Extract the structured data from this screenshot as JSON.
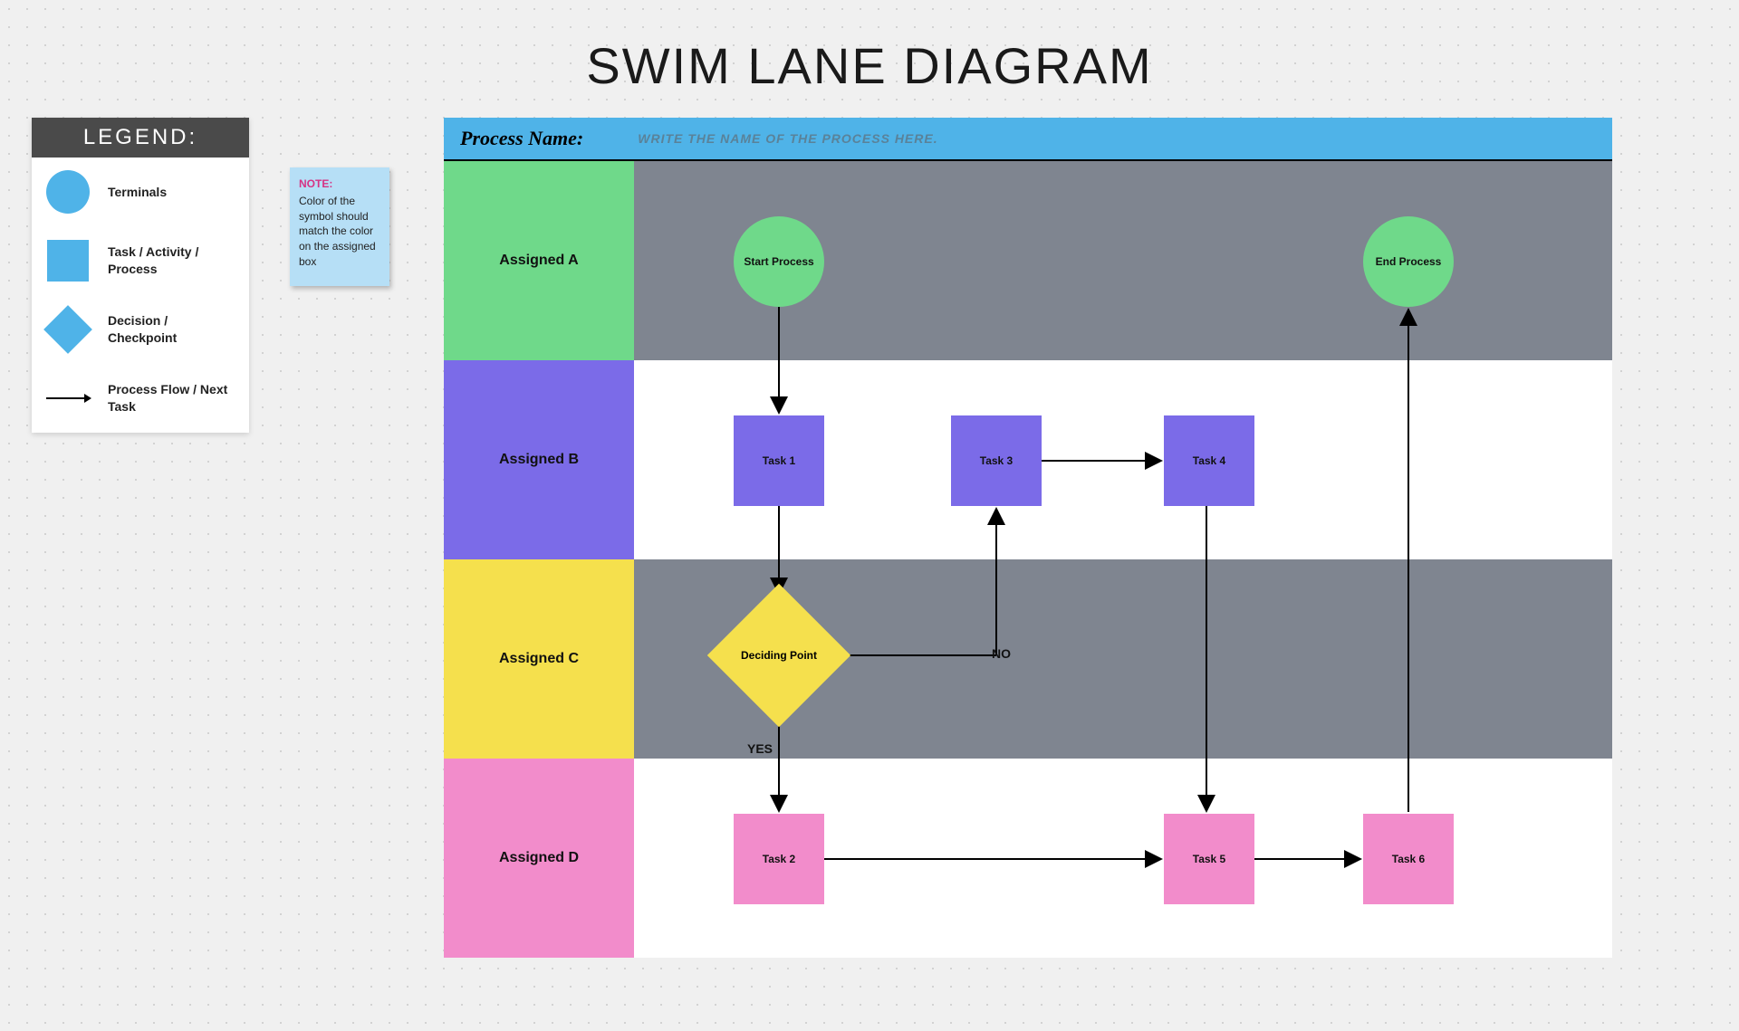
{
  "title": "SWIM LANE DIAGRAM",
  "legend": {
    "header": "LEGEND:",
    "items": [
      {
        "label": "Terminals"
      },
      {
        "label": "Task / Activity / Process"
      },
      {
        "label": "Decision / Checkpoint"
      },
      {
        "label": "Process Flow / Next Task"
      }
    ]
  },
  "note": {
    "label": "NOTE:",
    "body": "Color of the symbol should match the color on the assigned box"
  },
  "process": {
    "label": "Process Name:",
    "placeholder": "WRITE THE NAME OF THE PROCESS HERE."
  },
  "lanes": {
    "a": "Assigned A",
    "b": "Assigned B",
    "c": "Assigned C",
    "d": "Assigned D"
  },
  "nodes": {
    "start": "Start Process",
    "end": "End Process",
    "task1": "Task 1",
    "task2": "Task 2",
    "task3": "Task 3",
    "task4": "Task 4",
    "task5": "Task 5",
    "task6": "Task 6",
    "decision": "Deciding Point"
  },
  "edges": {
    "yes": "YES",
    "no": "NO"
  },
  "colors": {
    "blue": "#4fb3e8",
    "green": "#6fd98a",
    "purple": "#7b6be8",
    "yellow": "#f5e04d",
    "pink": "#f28ccb",
    "gray": "#7f8590"
  },
  "chart_data": {
    "type": "swimlane-flowchart",
    "title": "SWIM LANE DIAGRAM",
    "lanes": [
      {
        "id": "A",
        "label": "Assigned A",
        "color": "#6fd98a"
      },
      {
        "id": "B",
        "label": "Assigned B",
        "color": "#7b6be8"
      },
      {
        "id": "C",
        "label": "Assigned C",
        "color": "#f5e04d"
      },
      {
        "id": "D",
        "label": "Assigned D",
        "color": "#f28ccb"
      }
    ],
    "nodes": [
      {
        "id": "start",
        "lane": "A",
        "type": "terminal",
        "label": "Start Process"
      },
      {
        "id": "task1",
        "lane": "B",
        "type": "task",
        "label": "Task 1"
      },
      {
        "id": "decision",
        "lane": "C",
        "type": "decision",
        "label": "Deciding Point"
      },
      {
        "id": "task2",
        "lane": "D",
        "type": "task",
        "label": "Task 2"
      },
      {
        "id": "task3",
        "lane": "B",
        "type": "task",
        "label": "Task 3"
      },
      {
        "id": "task4",
        "lane": "B",
        "type": "task",
        "label": "Task 4"
      },
      {
        "id": "task5",
        "lane": "D",
        "type": "task",
        "label": "Task 5"
      },
      {
        "id": "task6",
        "lane": "D",
        "type": "task",
        "label": "Task 6"
      },
      {
        "id": "end",
        "lane": "A",
        "type": "terminal",
        "label": "End Process"
      }
    ],
    "edges": [
      {
        "from": "start",
        "to": "task1"
      },
      {
        "from": "task1",
        "to": "decision"
      },
      {
        "from": "decision",
        "to": "task2",
        "label": "YES"
      },
      {
        "from": "decision",
        "to": "task3",
        "label": "NO"
      },
      {
        "from": "task3",
        "to": "task4"
      },
      {
        "from": "task4",
        "to": "task5"
      },
      {
        "from": "task2",
        "to": "task5"
      },
      {
        "from": "task5",
        "to": "task6"
      },
      {
        "from": "task6",
        "to": "end"
      }
    ]
  }
}
